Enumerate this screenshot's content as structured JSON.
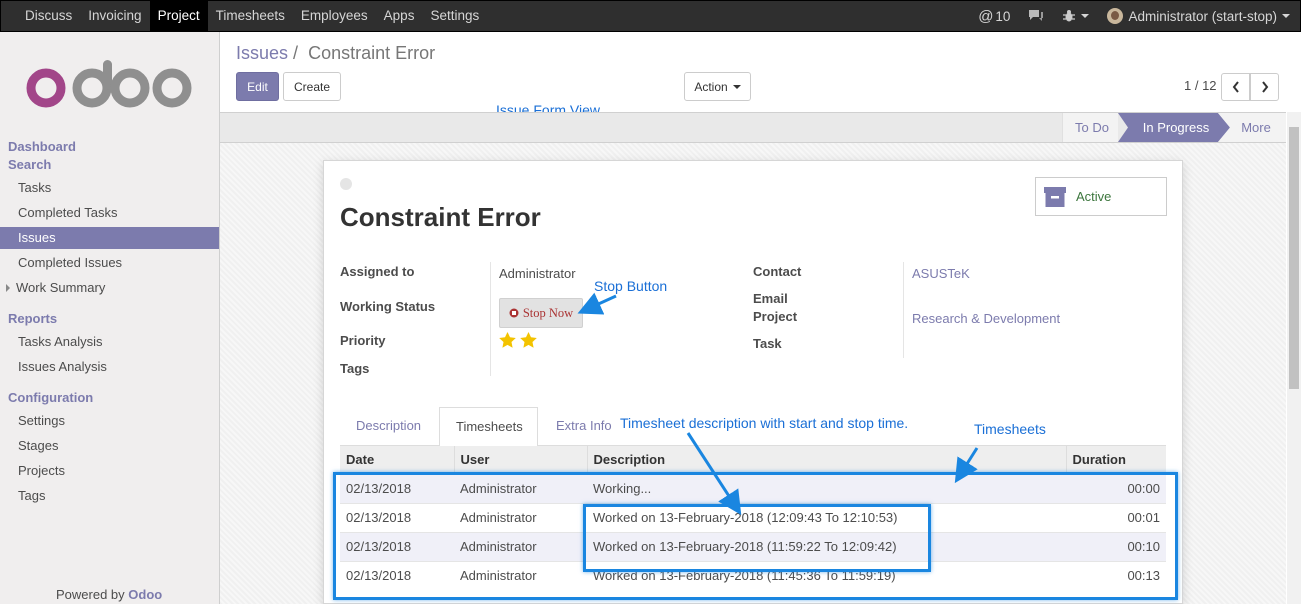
{
  "topbar": {
    "menu": [
      "Discuss",
      "Invoicing",
      "Project",
      "Timesheets",
      "Employees",
      "Apps",
      "Settings"
    ],
    "active": "Project",
    "notifications": "10",
    "user": "Administrator (start-stop)"
  },
  "sidebar": {
    "logo_text": "odoo",
    "dashboard": "Dashboard",
    "search": "Search",
    "search_items": [
      "Tasks",
      "Completed Tasks",
      "Issues",
      "Completed Issues",
      "Work Summary"
    ],
    "reports": "Reports",
    "report_items": [
      "Tasks Analysis",
      "Issues Analysis"
    ],
    "configuration": "Configuration",
    "config_items": [
      "Settings",
      "Stages",
      "Projects",
      "Tags"
    ],
    "powered_prefix": "Powered by",
    "powered_brand": "Odoo"
  },
  "control": {
    "breadcrumb_parent": "Issues",
    "breadcrumb_sep": "/",
    "breadcrumb_current": "Constraint Error",
    "edit": "Edit",
    "create": "Create",
    "action": "Action",
    "pager": "1 / 12"
  },
  "annotations": {
    "form_view": "Issue Form View",
    "stop_button": "Stop Button",
    "timesheet_desc": "Timesheet description with start and stop time.",
    "timesheets": "Timesheets"
  },
  "stages": [
    "To Do",
    "In Progress",
    "More"
  ],
  "active_stage": "In Progress",
  "form": {
    "title": "Constraint Error",
    "active_label": "Active",
    "assigned_to_label": "Assigned to",
    "assigned_to": "Administrator",
    "working_status_label": "Working Status",
    "stop_now": "Stop Now",
    "priority_label": "Priority",
    "priority_stars": 2,
    "tags_label": "Tags",
    "contact_label": "Contact",
    "contact": "ASUSTeK",
    "email_label": "Email",
    "project_label": "Project",
    "project": "Research & Development",
    "task_label": "Task"
  },
  "tabs": [
    "Description",
    "Timesheets",
    "Extra Info"
  ],
  "active_tab": "Timesheets",
  "timesheets": {
    "columns": [
      "Date",
      "User",
      "Description",
      "Duration"
    ],
    "rows": [
      [
        "02/13/2018",
        "Administrator",
        "Working...",
        "00:00"
      ],
      [
        "02/13/2018",
        "Administrator",
        "Worked on 13-February-2018 (12:09:43 To 12:10:53)",
        "00:01"
      ],
      [
        "02/13/2018",
        "Administrator",
        "Worked on 13-February-2018 (11:59:22 To 12:09:42)",
        "00:10"
      ],
      [
        "02/13/2018",
        "Administrator",
        "Worked on 13-February-2018 (11:45:36 To 11:59:19)",
        "00:13"
      ]
    ]
  },
  "colors": {
    "brand": "#7c7bad",
    "annotation": "#1a86e0",
    "star": "#f3c300"
  }
}
